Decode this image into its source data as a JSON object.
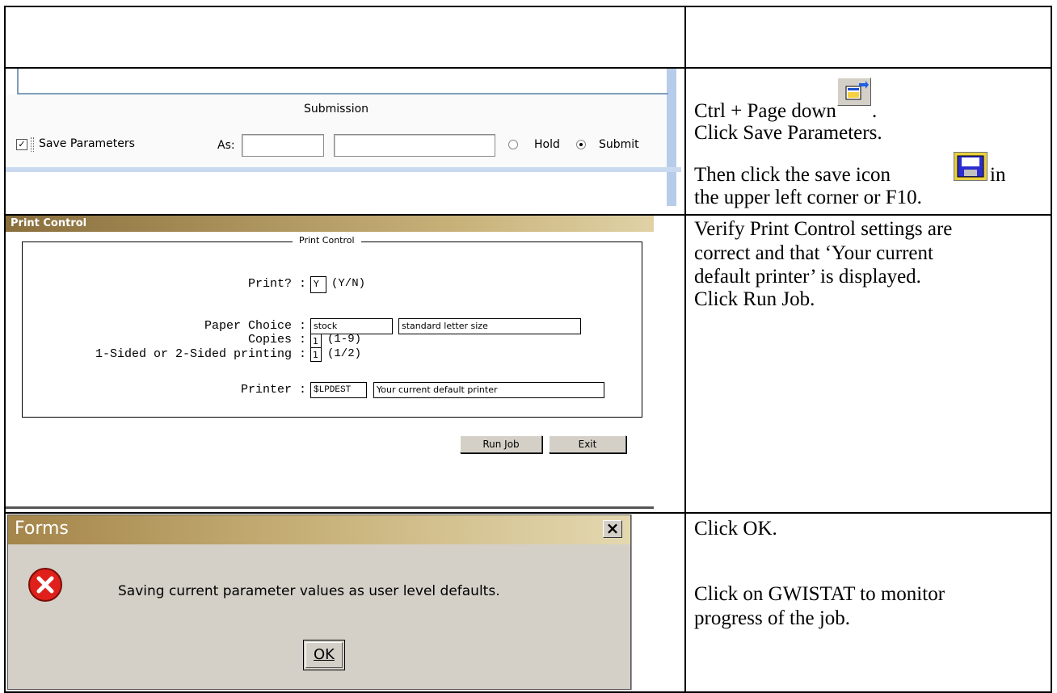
{
  "row2": {
    "submission_title": "Submission",
    "save_params_label": "Save Parameters",
    "as_label": "As:",
    "hold_label": "Hold",
    "submit_label": "Submit",
    "instr_line1": "Ctrl + Page down",
    "instr_line1_end": ".",
    "instr_line2": "Click Save Parameters.",
    "instr_line3_a": "Then click the save icon",
    "instr_line3_b": "in",
    "instr_line4": "the upper left corner or F10."
  },
  "row3": {
    "window_title": "Print Control",
    "group_title": "Print Control",
    "print_label": "Print? :",
    "print_value": "Y",
    "print_hint": "(Y/N)",
    "paper_label": "Paper Choice :",
    "paper_value": "stock",
    "paper_desc": "standard letter size",
    "copies_label": "Copies :",
    "copies_value": "1",
    "copies_hint": "(1-9)",
    "sided_label": "1-Sided or 2-Sided printing :",
    "sided_value": "1",
    "sided_hint": "(1/2)",
    "printer_label": "Printer :",
    "printer_value": "$LPDEST",
    "printer_desc": "Your current default printer",
    "run_job_label": "Run Job",
    "exit_label": "Exit",
    "instr": [
      "Verify Print Control settings are",
      "correct and that ‘Your current",
      "default printer’ is displayed.",
      "Click Run Job."
    ]
  },
  "row4": {
    "dialog_title": "Forms",
    "close_glyph": "×",
    "message": "Saving current parameter values as user level defaults.",
    "ok_label": "OK",
    "instr1": "Click OK.",
    "instr2": [
      "Click on GWISTAT to monitor",
      "progress of the job."
    ]
  },
  "colors": {
    "titlebar_gold": "#c8b27a",
    "dialog_bg": "#d4d0c8",
    "error_red": "#e0201a",
    "window_blue": "#a8c4e8"
  }
}
